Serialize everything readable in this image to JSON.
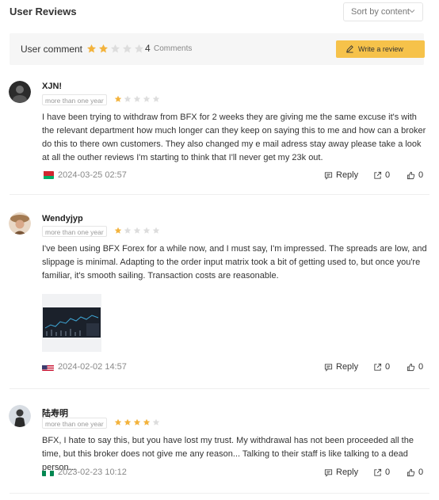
{
  "header": {
    "title": "User Reviews",
    "sort_label": "Sort by content",
    "sort_icon": "chevron-down-icon"
  },
  "summary": {
    "label": "User comment",
    "rating_stars": 2,
    "max_stars": 5,
    "count": "4",
    "count_label": "Comments",
    "write_label": "Write a review",
    "write_icon": "pencil-icon"
  },
  "colors": {
    "star_active": "#f3b33d",
    "star_inactive": "#dddddd",
    "button": "#f6c24a"
  },
  "reviews": [
    {
      "name": "XJN!",
      "tenure": "more than one year",
      "stars": 1,
      "text": "I have been trying to withdraw from BFX for 2 weeks they are giving me the same excuse it's with the relevant department how much longer can they keep on saying this to me and how can a broker do this to there own customers. They also changed my e mail adress stay away please take a look at all the outher reviews I'm starting to think that I'll never get my 23k out.",
      "flag": "belarus-flag",
      "date": "2024-03-25 02:57",
      "reply_label": "Reply",
      "share_count": "0",
      "like_count": "0"
    },
    {
      "name": "Wendyjyp",
      "tenure": "more than one year",
      "stars": 1,
      "text": "I've been using BFX Forex for a while now, and I must say, I'm impressed. The spreads are low, and slippage is minimal. Adapting to the order input matrix took a bit of getting used to, but once you're familiar, it's smooth sailing. Transaction costs are reasonable.",
      "flag": "us-flag",
      "date": "2024-02-02 14:57",
      "reply_label": "Reply",
      "share_count": "0",
      "like_count": "0"
    },
    {
      "name": "陆寿明",
      "tenure": "more than one year",
      "stars": 4,
      "text": "BFX, I hate to say this, but you have lost my trust. My withdrawal has not been proceeded all the time, but this broker does not give me any reason... Talking to their staff is like talking to a dead person...",
      "flag": "nigeria-flag",
      "date": "2023-02-23 10:12",
      "reply_label": "Reply",
      "share_count": "0",
      "like_count": "0"
    }
  ]
}
